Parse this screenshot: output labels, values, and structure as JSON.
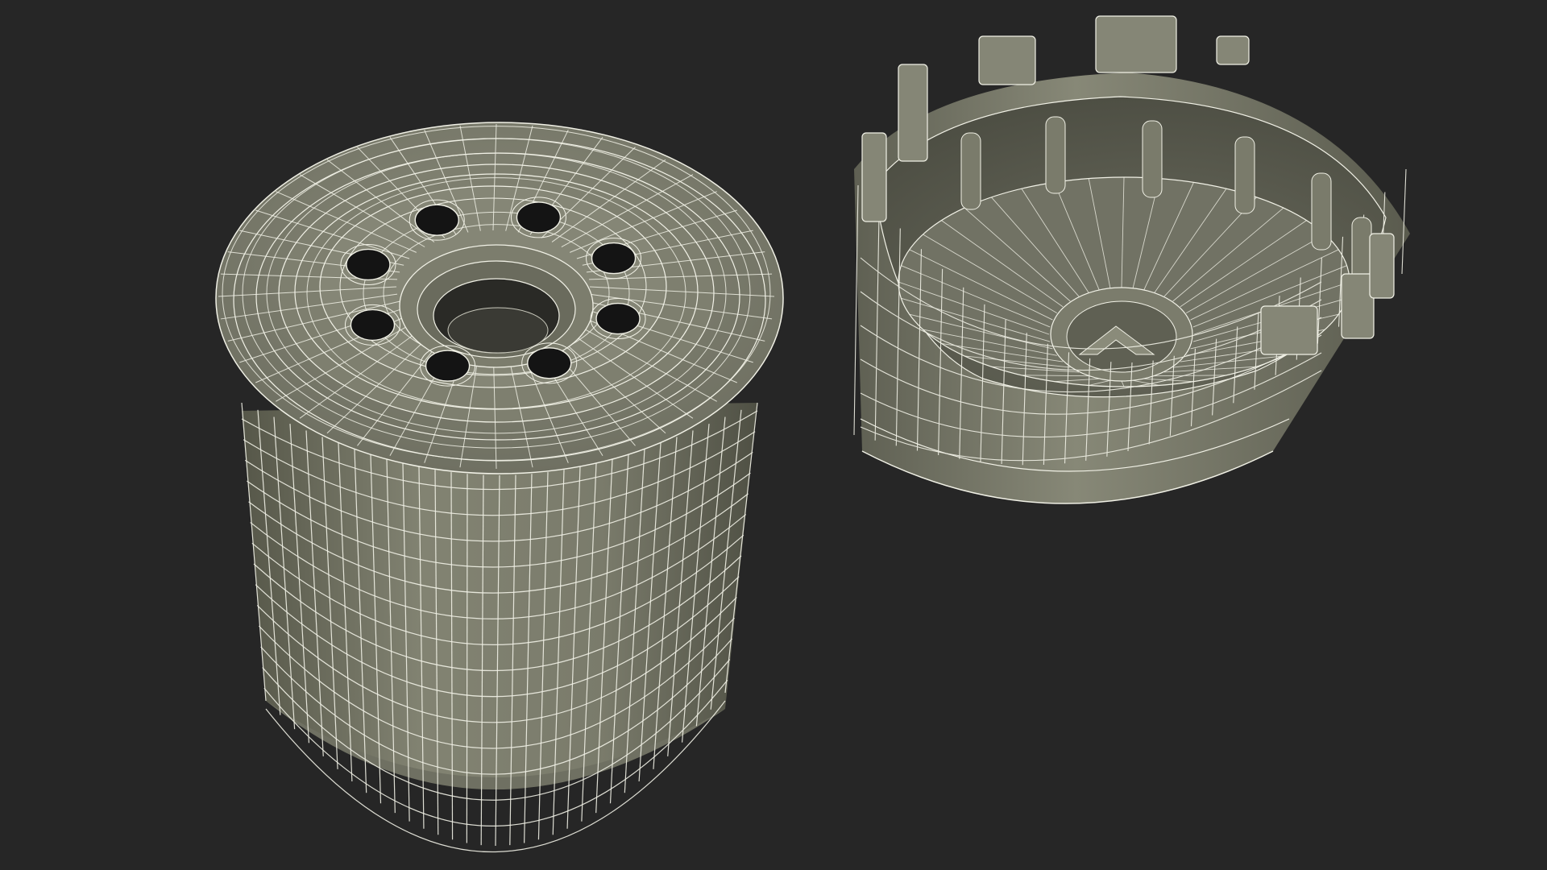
{
  "scene": {
    "background_color": "#262626",
    "surface_color": "#7b7c6c",
    "surface_shadow_color": "#5d5e52",
    "wire_color": "#f1f1e6",
    "hole_color": "#141414",
    "objects": [
      {
        "name": "oil-filter",
        "description_visible": false
      },
      {
        "name": "oil-filter-wrench-cap",
        "description_visible": false
      }
    ]
  }
}
